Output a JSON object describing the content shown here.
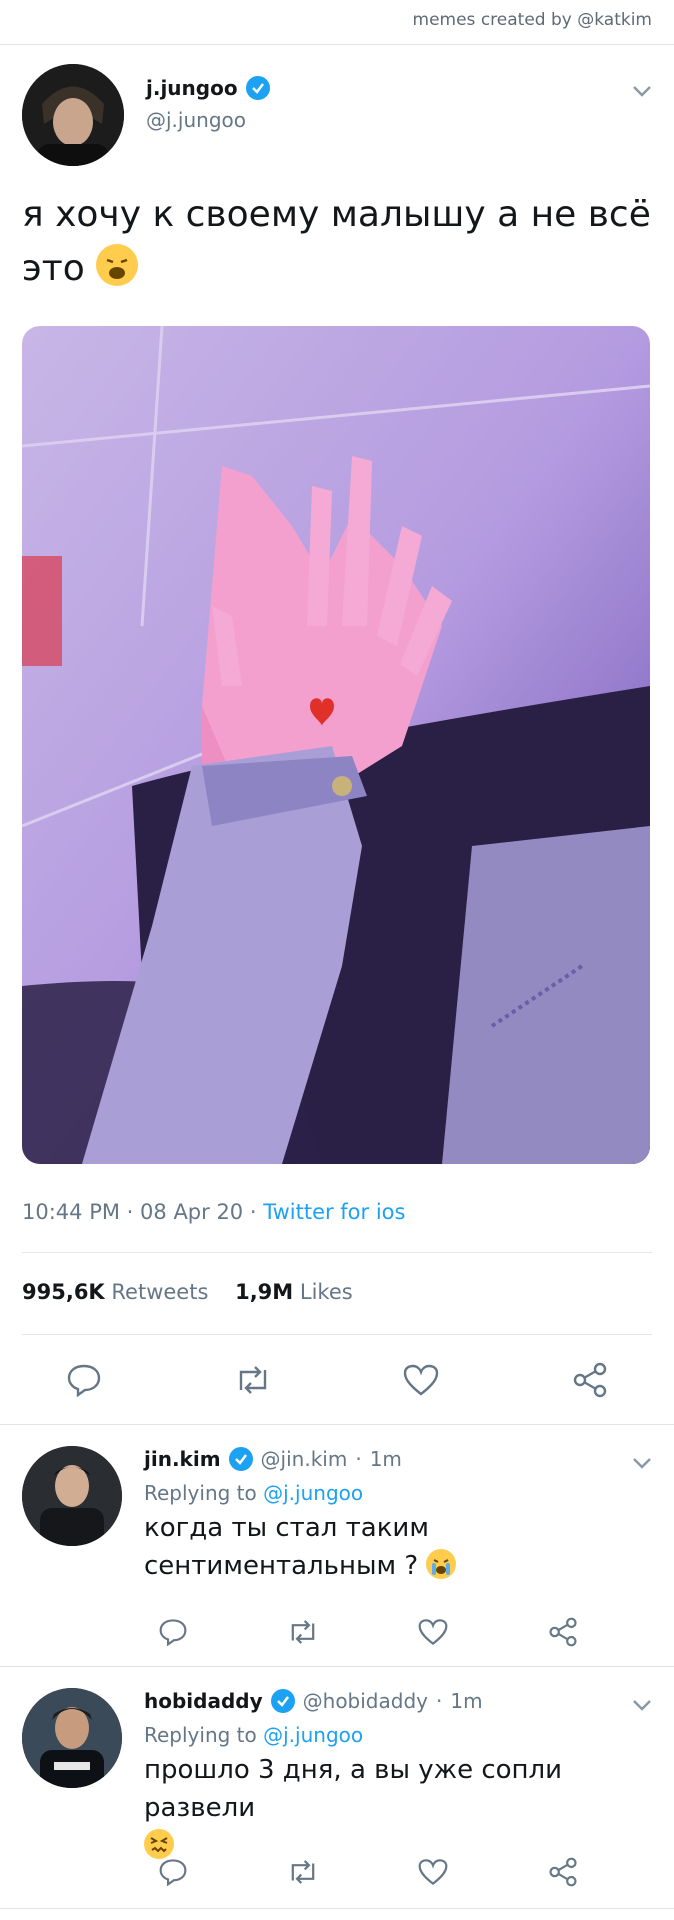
{
  "header": {
    "credit": "memes created by @katkim"
  },
  "tweet": {
    "name": "j.jungoo",
    "handle": "@j.jungoo",
    "text": "я хочу к своему малышу а не всё это",
    "emoji": "weary-face",
    "media": {
      "description_icon": "photo",
      "sticker": "heart"
    },
    "time": "10:44 PM",
    "date": "08 Apr 20",
    "source": "Twitter for ios",
    "retweets_count": "995,6K",
    "retweets_label": "Retweets",
    "likes_count": "1,9M",
    "likes_label": "Likes"
  },
  "replies": [
    {
      "name": "jin.kim",
      "handle": "@jin.kim",
      "time": "1m",
      "replying_label": "Replying to",
      "replying_to": "@j.jungoo",
      "text": "когда ты стал таким сентиментальным ?",
      "emoji": "crying-face"
    },
    {
      "name": "hobidaddy",
      "handle": "@hobidaddy",
      "time": "1m",
      "replying_label": "Replying to",
      "replying_to": "@j.jungoo",
      "text": "прошло 3 дня, а вы уже сопли развели",
      "emoji": "confounded-face"
    }
  ],
  "colors": {
    "accent": "#1da1f2",
    "text": "#14171a",
    "muted": "#657786"
  },
  "separator": "·"
}
